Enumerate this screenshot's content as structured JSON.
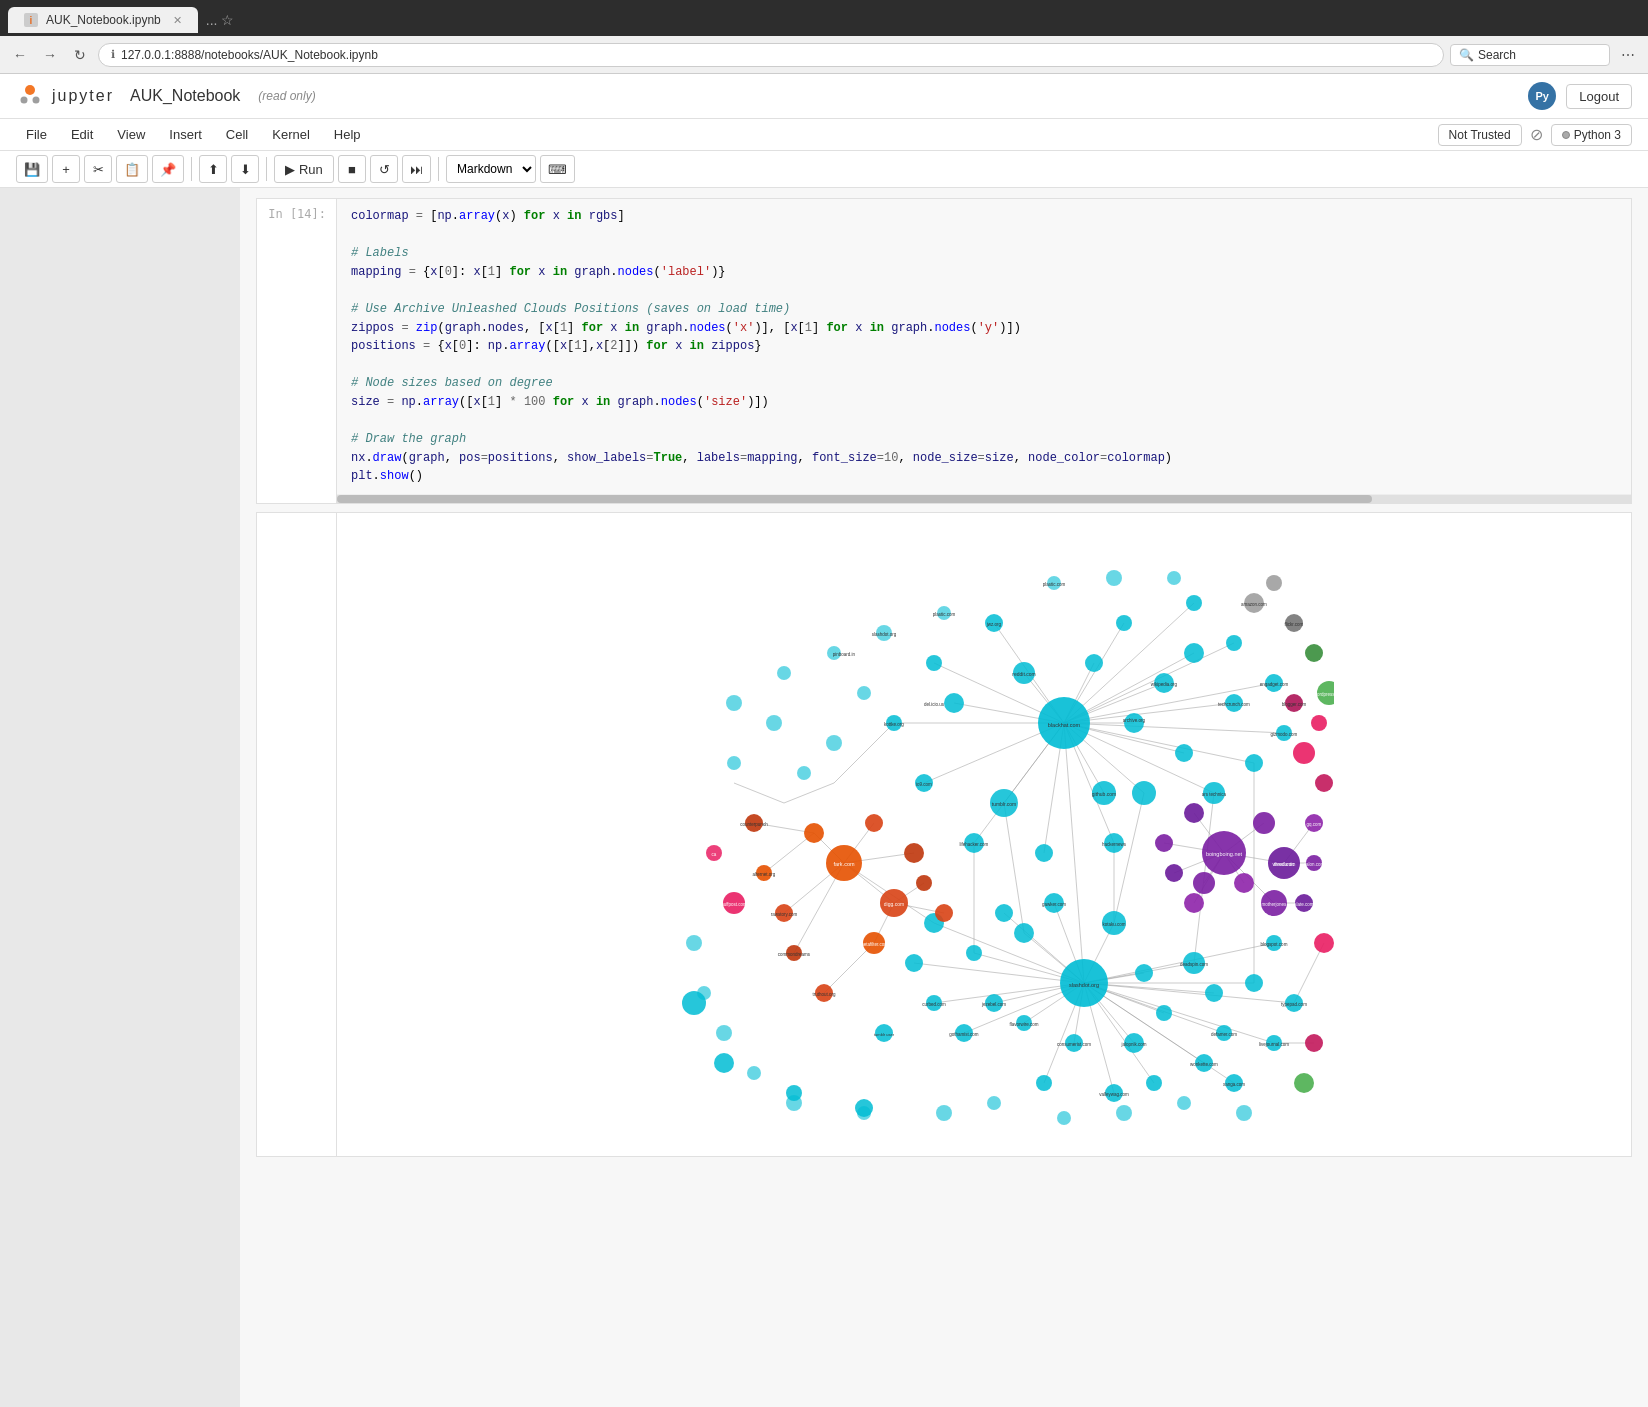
{
  "browser": {
    "tab_title": "AUK_Notebook.ipynb",
    "favicon_text": "i",
    "address": "127.0.0.1:8888/notebooks/AUK_Notebook.ipynb",
    "search_placeholder": "Search",
    "search_value": "Search",
    "more_icon": "⋯",
    "bookmark_icon": "☆",
    "tab_indicators": "..."
  },
  "jupyter": {
    "brand": "jupyter",
    "notebook_title": "AUK_Notebook",
    "readonly_label": "(read only)",
    "menus": [
      "File",
      "Edit",
      "View",
      "Insert",
      "Cell",
      "Kernel",
      "Help"
    ],
    "not_trusted": "Not Trusted",
    "kernel_name": "Python 3",
    "logout_label": "Logout",
    "cell_type": "Markdown"
  },
  "toolbar": {
    "buttons": [
      "💾",
      "+",
      "✂",
      "📋",
      "⬆",
      "⬇",
      "▶ Run",
      "■",
      "↺",
      "⏭"
    ]
  },
  "code": {
    "line1": "colormap = [np.array(x) for x in rgbs]",
    "comment_labels": "# Labels",
    "line_labels": "mapping = {x[0]: x[1] for x in graph.nodes('label')}",
    "comment_positions": "# Use Archive Unleashed Clouds Positions (saves on load time)",
    "line_zippos": "zippos = zip(graph.nodes, [x[1] for x in graph.nodes('x')], [x[1] for x in graph.nodes('y')])",
    "line_positions": "positions = {x[0]: np.array([x[1],x[2]]) for x in zippos}",
    "comment_sizes": "# Node sizes based on degree",
    "line_size": "size = np.array([x[1] * 100 for x in graph.nodes('size')])",
    "comment_draw": "# Draw the graph",
    "line_draw": "nx.draw(graph, pos=positions, show_labels=True, labels=mapping, font_size=10, node_size=size, node_color=colormap)",
    "line_show": "plt.show()"
  },
  "graph": {
    "description": "Network graph visualization of web domains",
    "node_colors": {
      "teal": "#00BCD4",
      "purple": "#7B1FA2",
      "orange_red": "#D84315",
      "magenta": "#E91E63",
      "green": "#4CAF50",
      "gray": "#9E9E9E",
      "light_teal": "#4DD0E1",
      "dark_red": "#B71C1C"
    }
  },
  "sidebar": {
    "visible": true
  }
}
